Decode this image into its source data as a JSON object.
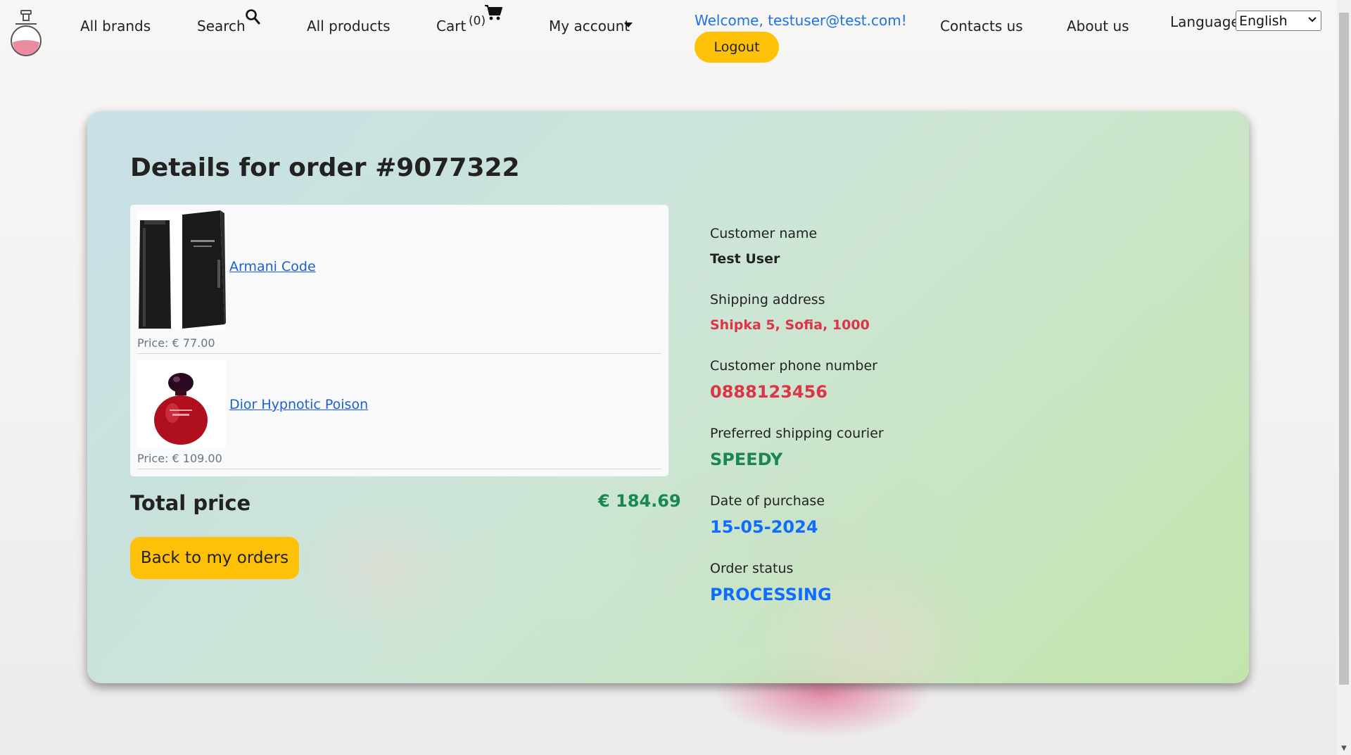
{
  "nav": {
    "brands": "All brands",
    "search": "Search",
    "products": "All products",
    "cart": "Cart",
    "cart_count": "(0)",
    "account": "My account",
    "welcome": "Welcome, testuser@test.com!",
    "logout": "Logout",
    "contacts": "Contacts us",
    "about": "About us",
    "language_label": "Language",
    "language_value": "English"
  },
  "order": {
    "title": "Details for order #9077322",
    "items": [
      {
        "name": "Armani Code",
        "price": "Price: € 77.00"
      },
      {
        "name": "Dior Hypnotic Poison",
        "price": "Price: € 109.00"
      }
    ],
    "total_label": "Total price",
    "total_value": "€ 184.69",
    "back_label": "Back to my orders"
  },
  "info": {
    "customer_name_label": "Customer name",
    "customer_name": "Test User",
    "address_label": "Shipping address",
    "address": "Shipka 5, Sofia, 1000",
    "phone_label": "Customer phone number",
    "phone": "0888123456",
    "courier_label": "Preferred shipping courier",
    "courier": "SPEEDY",
    "date_label": "Date of purchase",
    "date": "15-05-2024",
    "status_label": "Order status",
    "status": "PROCESSING"
  },
  "colors": {
    "accent_yellow": "#ffc107",
    "link_blue": "#1a5fd6",
    "red": "#dc3545",
    "green": "#198754",
    "blue": "#0d6efd"
  }
}
